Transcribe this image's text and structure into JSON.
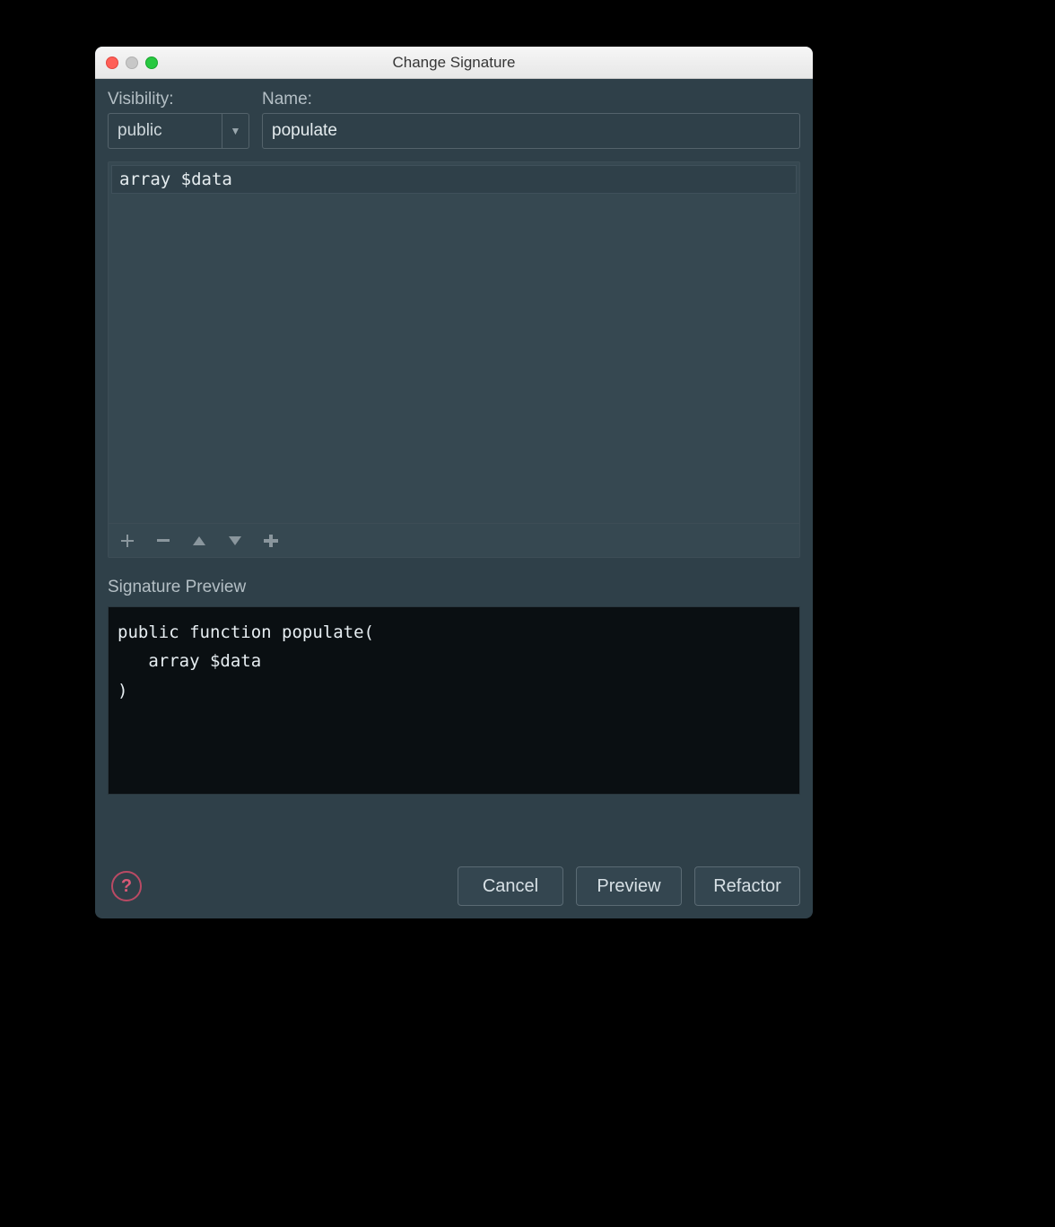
{
  "window": {
    "title": "Change Signature"
  },
  "labels": {
    "visibility": "Visibility:",
    "name": "Name:",
    "signature_preview": "Signature Preview"
  },
  "visibility": {
    "value": "public"
  },
  "name": {
    "value": "populate"
  },
  "parameters": [
    {
      "text": "array $data"
    }
  ],
  "preview": {
    "line1": "public function populate(",
    "line2": "   array $data",
    "line3": ")"
  },
  "buttons": {
    "cancel": "Cancel",
    "preview": "Preview",
    "refactor": "Refactor"
  }
}
